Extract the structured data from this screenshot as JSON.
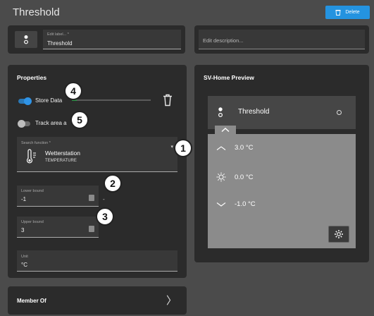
{
  "header": {
    "title": "Threshold",
    "delete_label": "Delete"
  },
  "label": {
    "caption": "Edit label... *",
    "value": "Threshold"
  },
  "description": {
    "placeholder": "Edit description..."
  },
  "properties": {
    "title": "Properties",
    "store_data": {
      "label": "Store Data",
      "enabled": true
    },
    "track_area": {
      "label": "Track area a",
      "enabled": false
    },
    "slider_level": 0.06,
    "search": {
      "caption": "Search function *",
      "name": "Wetterstation",
      "type": "TEMPERATURE"
    },
    "lower_bound": {
      "caption": "Lower bound",
      "value": "-1"
    },
    "upper_bound": {
      "caption": "Upper bound",
      "value": "3"
    },
    "range_separator": "-",
    "unit": {
      "caption": "Unit",
      "value": "°C"
    }
  },
  "member_of": {
    "title": "Member Of"
  },
  "preview": {
    "title": "SV-Home Preview",
    "device_name": "Threshold",
    "rows": [
      {
        "icon": "upper-bound-icon",
        "value": "3.0 °C"
      },
      {
        "icon": "sun-icon",
        "value": "0.0 °C"
      },
      {
        "icon": "lower-bound-icon",
        "value": "-1.0 °C"
      }
    ]
  },
  "markers": [
    "1",
    "2",
    "3",
    "4",
    "5"
  ],
  "colors": {
    "accent": "#2493e0",
    "toggle_on": "#2f93e6",
    "slider_fill": "#2f9a4a"
  }
}
